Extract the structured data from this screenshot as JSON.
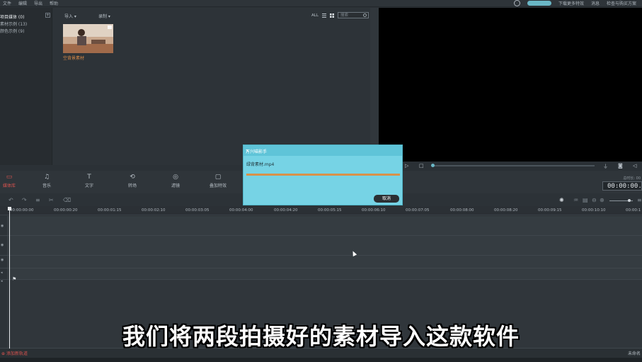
{
  "menu": [
    "文件",
    "编辑",
    "导出",
    "帮助"
  ],
  "topbar_right": [
    "下载更多特效",
    "消息",
    "检查与购买方案"
  ],
  "sidebar": {
    "items": [
      "项目媒体 (0)",
      "素材示例 (13)",
      "颜色示例 (9)"
    ],
    "add_label": "+"
  },
  "library": {
    "import_label": "导入 ▾",
    "record_label": "录制 ▾",
    "all_label": "ALL",
    "search_placeholder": "搜索",
    "thumbnail_label": "空背景素材"
  },
  "tools": [
    "媒体库",
    "音乐",
    "文字",
    "转场",
    "滤镜",
    "叠加特效"
  ],
  "tool_icons": [
    "folder-icon",
    "music-note-icon",
    "text-icon",
    "transition-icon",
    "filter-icon",
    "overlay-icon"
  ],
  "timecode": {
    "label": "总时长: 00",
    "value": "00:00:00."
  },
  "ruler_ticks": [
    "00:00:00:00",
    "00:00:00:20",
    "00:00:01:15",
    "00:00:02:10",
    "00:00:03:05",
    "00:00:04:00",
    "00:00:04:20",
    "00:00:05:15",
    "00:00:06:10",
    "00:00:07:05",
    "00:00:08:00",
    "00:00:08:20",
    "00:00:09:15",
    "00:00:10:10",
    "00:00:1"
  ],
  "bottom": {
    "left": "添加新轨道",
    "right": "未命名"
  },
  "dialog": {
    "title": "万兴喵影手",
    "file": "绿背素材.mp4",
    "progress": 1.0,
    "cancel_label": "取消",
    "close_label": "✕"
  },
  "subtitle": "我们将两段拍摄好的素材导入这款软件",
  "colors": {
    "accent": "#6ab7c6",
    "active_tool": "#d9534f",
    "dialog_bg": "#76d3e5",
    "progress_fill": "#d8924a"
  }
}
